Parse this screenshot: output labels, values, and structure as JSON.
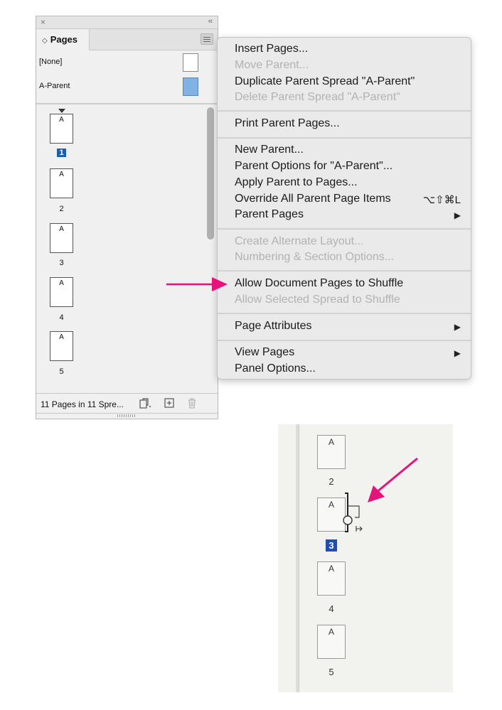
{
  "panel": {
    "close_glyph": "×",
    "collapse_glyph": "‹‹",
    "tab_label": "Pages",
    "tab_chevron": "◇",
    "parents": [
      {
        "label": "[None]",
        "thumb_color": "#ffffff"
      },
      {
        "label": "A-Parent",
        "thumb_color": "#7fb2e5"
      }
    ],
    "pages": [
      {
        "letter": "A",
        "number": "1",
        "selected": true
      },
      {
        "letter": "A",
        "number": "2",
        "selected": false
      },
      {
        "letter": "A",
        "number": "3",
        "selected": false
      },
      {
        "letter": "A",
        "number": "4",
        "selected": false
      },
      {
        "letter": "A",
        "number": "5",
        "selected": false
      }
    ],
    "status": "11 Pages in 11 Spre...",
    "footer_icons": [
      "edit-page-size-icon",
      "new-page-icon",
      "trash-icon"
    ]
  },
  "menu": {
    "items": [
      {
        "label": "Insert Pages...",
        "disabled": false
      },
      {
        "label": "Move Parent...",
        "disabled": true
      },
      {
        "label": "Duplicate Parent Spread \"A-Parent\"",
        "disabled": false
      },
      {
        "label": "Delete Parent Spread \"A-Parent\"",
        "disabled": true
      },
      {
        "label": "Print Parent Pages...",
        "disabled": false
      },
      {
        "label": "New Parent...",
        "disabled": false
      },
      {
        "label": "Parent Options for \"A-Parent\"...",
        "disabled": false
      },
      {
        "label": "Apply Parent to Pages...",
        "disabled": false
      },
      {
        "label": "Override All Parent Page Items",
        "disabled": false,
        "shortcut": "⌥⇧⌘L"
      },
      {
        "label": "Parent Pages",
        "disabled": false,
        "submenu": true
      },
      {
        "label": "Create Alternate Layout...",
        "disabled": true
      },
      {
        "label": "Numbering & Section Options...",
        "disabled": true
      },
      {
        "label": "Allow Document Pages to Shuffle",
        "disabled": false
      },
      {
        "label": "Allow Selected Spread to Shuffle",
        "disabled": true
      },
      {
        "label": "Page Attributes",
        "disabled": false,
        "submenu": true
      },
      {
        "label": "View Pages",
        "disabled": false,
        "submenu": true
      },
      {
        "label": "Panel Options...",
        "disabled": false
      }
    ],
    "submenu_glyph": "▶"
  },
  "annotation": {
    "arrow_color": "#e6137a"
  },
  "inset": {
    "pages": [
      {
        "letter": "A",
        "number": "2",
        "selected": false
      },
      {
        "letter": "A",
        "number": "3",
        "selected": true
      },
      {
        "letter": "A",
        "number": "4",
        "selected": false
      },
      {
        "letter": "A",
        "number": "5",
        "selected": false
      }
    ]
  }
}
